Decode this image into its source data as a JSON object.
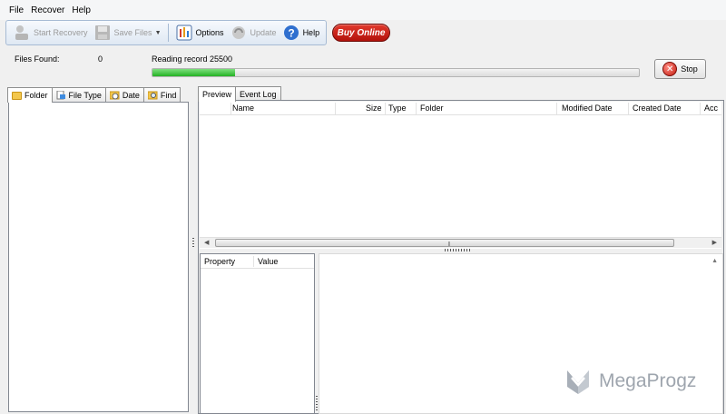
{
  "menu": {
    "items": [
      {
        "label": "File"
      },
      {
        "label": "Recover"
      },
      {
        "label": "Help"
      }
    ]
  },
  "toolbar": {
    "start_recovery": "Start Recovery",
    "save_files": "Save Files",
    "options": "Options",
    "update": "Update",
    "help": "Help",
    "buy_online": "Buy Online"
  },
  "status": {
    "files_found_label": "Files Found:",
    "files_found_value": "0",
    "reading_text": "Reading record 25500",
    "progress_percent": 17,
    "stop_label": "Stop"
  },
  "left_tabs": [
    {
      "label": "Folder",
      "icon": "folder-icon"
    },
    {
      "label": "File Type",
      "icon": "file-type-icon"
    },
    {
      "label": "Date",
      "icon": "date-icon"
    },
    {
      "label": "Find",
      "icon": "find-icon"
    }
  ],
  "right_tabs": [
    {
      "label": "Preview"
    },
    {
      "label": "Event Log"
    }
  ],
  "table": {
    "columns": [
      "Name",
      "Size",
      "Type",
      "Folder",
      "Modified Date",
      "Created Date",
      "Acc"
    ]
  },
  "properties": {
    "columns": [
      "Property",
      "Value"
    ]
  },
  "watermark": {
    "text": "MegaProgz"
  },
  "colors": {
    "buy_online": "#c8170f",
    "progress": "#2cc62c",
    "panel_border": "#828790"
  }
}
